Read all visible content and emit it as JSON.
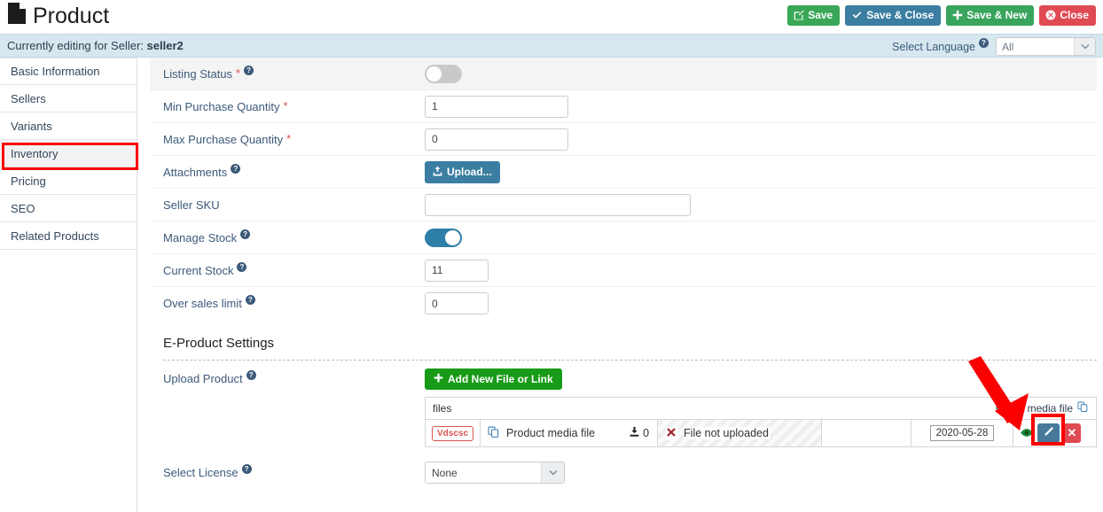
{
  "header": {
    "title": "Product",
    "doc_icon": "document-icon",
    "buttons": [
      {
        "label": "Save",
        "icon": "edit-square-icon",
        "color": "#3aa757",
        "style": "green"
      },
      {
        "label": "Save & Close",
        "icon": "check-icon",
        "color": "#3b7ea1",
        "style": "blue"
      },
      {
        "label": "Save & New",
        "icon": "plus-icon",
        "color": "#38a45c",
        "style": "green2"
      },
      {
        "label": "Close",
        "icon": "circle-x-icon",
        "color": "#e04a52",
        "style": "red"
      }
    ]
  },
  "seller_bar": {
    "prefix": "Currently editing for Seller:",
    "seller_name": "seller2",
    "language_label": "Select Language",
    "language_value": "All",
    "help_icon": "question-mark-icon",
    "caret_icon": "chevron-down-icon"
  },
  "sidebar": {
    "items": [
      {
        "label": "Basic Information",
        "active": false
      },
      {
        "label": "Sellers",
        "active": false
      },
      {
        "label": "Variants",
        "active": false
      },
      {
        "label": "Inventory",
        "active": true
      },
      {
        "label": "Pricing",
        "active": false
      },
      {
        "label": "SEO",
        "active": false
      },
      {
        "label": "Related Products",
        "active": false
      }
    ],
    "highlight_color": "#fb0000"
  },
  "form": {
    "listing_status": {
      "label": "Listing Status",
      "required": true,
      "help": true,
      "toggle": "off"
    },
    "min_purchase": {
      "label": "Min Purchase Quantity",
      "required": true,
      "help": false,
      "value": "1"
    },
    "max_purchase": {
      "label": "Max Purchase Quantity",
      "required": true,
      "help": false,
      "value": "0"
    },
    "attachments": {
      "label": "Attachments",
      "required": false,
      "help": true,
      "button_label": "Upload...",
      "button_icon": "upload-icon"
    },
    "seller_sku": {
      "label": "Seller SKU",
      "required": false,
      "help": false,
      "value": ""
    },
    "manage_stock": {
      "label": "Manage Stock",
      "required": false,
      "help": true,
      "toggle": "on"
    },
    "current_stock": {
      "label": "Current Stock",
      "required": false,
      "help": true,
      "value": "11"
    },
    "over_sales": {
      "label": "Over sales limit",
      "required": false,
      "help": true,
      "value": "0"
    }
  },
  "eproduct": {
    "section_title": "E-Product Settings",
    "upload_product": {
      "label": "Upload Product",
      "help": true,
      "add_button_label": "Add New File or Link",
      "add_button_icon": "plus-icon"
    },
    "file_table": {
      "header_left": "files",
      "header_right": "Latest media file",
      "header_right_icon": "copy-files-icon",
      "rows": [
        {
          "tag": "Vdscsc",
          "file_icon": "copy-files-icon",
          "name": "Product media file",
          "download_icon": "download-icon",
          "download_count": "0",
          "status_icon": "x-mark-icon",
          "status": "File not uploaded",
          "date": "2020-05-28",
          "actions": [
            {
              "name": "preview",
              "icon": "eye-icon"
            },
            {
              "name": "edit",
              "icon": "pencil-icon",
              "highlighted": true
            },
            {
              "name": "delete",
              "icon": "x-icon"
            }
          ]
        }
      ]
    },
    "select_license": {
      "label": "Select License",
      "help": true,
      "value": "None",
      "caret_icon": "chevron-down-icon"
    }
  },
  "annotation": {
    "arrow_color": "#fb0000",
    "arrow_target": "edit-button"
  }
}
